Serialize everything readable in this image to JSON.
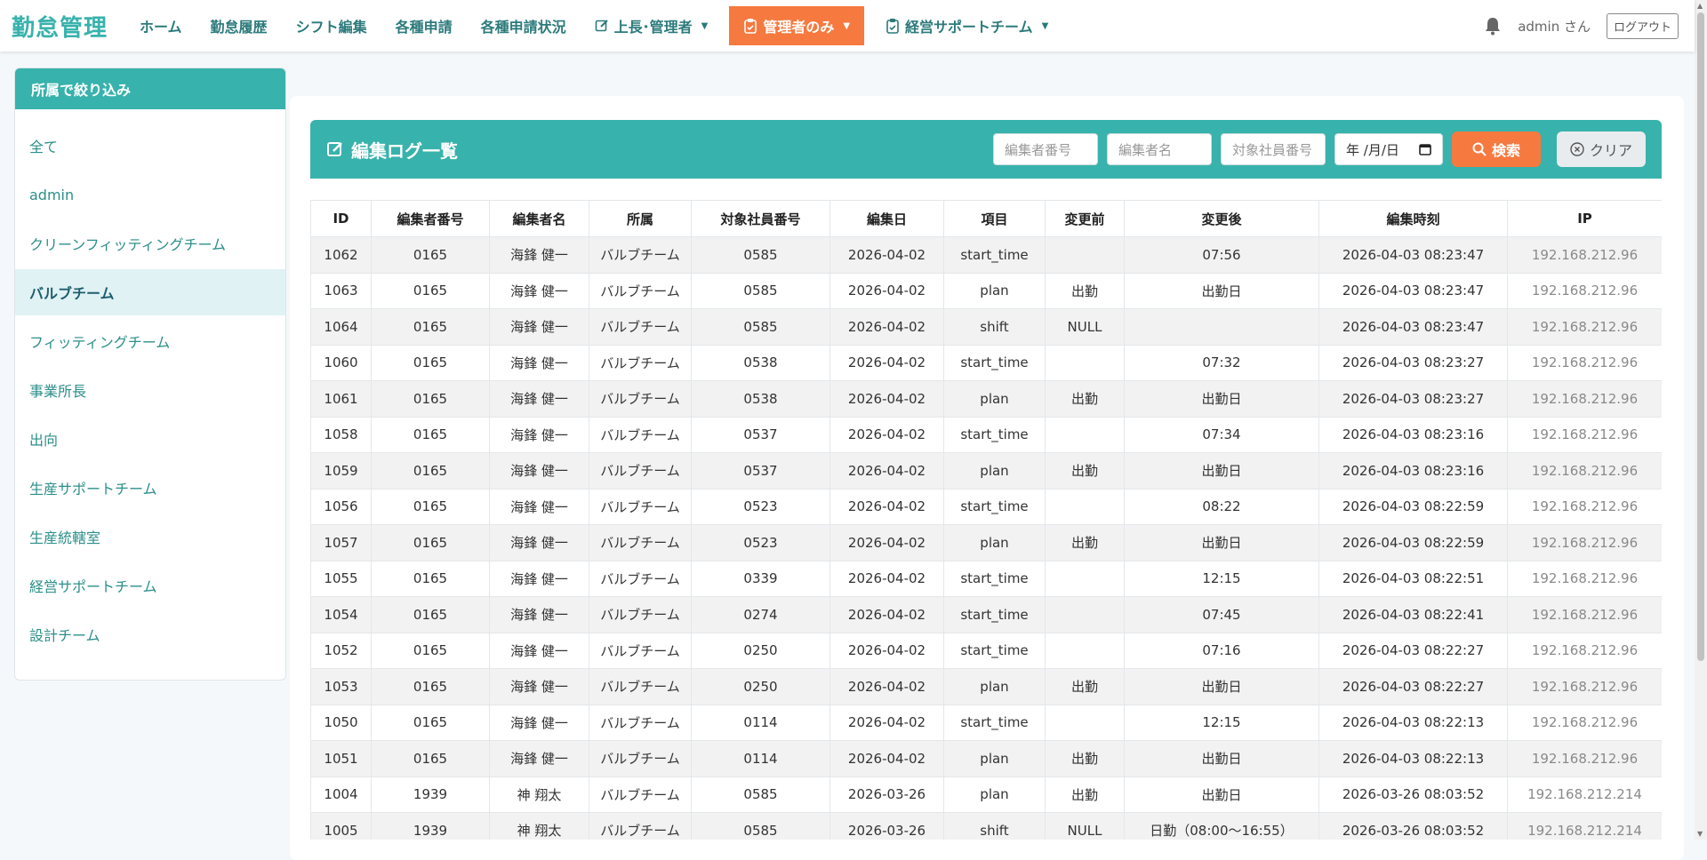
{
  "nav": {
    "brand": "勤怠管理",
    "items": [
      {
        "label": "ホーム"
      },
      {
        "label": "勤怠履歴"
      },
      {
        "label": "シフト編集"
      },
      {
        "label": "各種申請"
      },
      {
        "label": "各種申請状況"
      },
      {
        "label": "上長･管理者"
      },
      {
        "label": "管理者のみ"
      },
      {
        "label": "経営サポートチーム"
      }
    ],
    "user": "admin さん",
    "logout": "ログアウト"
  },
  "sidebar": {
    "title": "所属で絞り込み",
    "items": [
      {
        "label": "全て"
      },
      {
        "label": "admin"
      },
      {
        "label": "クリーンフィッティングチーム"
      },
      {
        "label": "バルブチーム"
      },
      {
        "label": "フィッティングチーム"
      },
      {
        "label": "事業所長"
      },
      {
        "label": "出向"
      },
      {
        "label": "生産サポートチーム"
      },
      {
        "label": "生産統轄室"
      },
      {
        "label": "経営サポートチーム"
      },
      {
        "label": "設計チーム"
      }
    ]
  },
  "panel": {
    "title": "編集ログ一覧",
    "filters": {
      "editor_no_placeholder": "編集者番号",
      "editor_name_placeholder": "編集者名",
      "target_no_placeholder": "対象社員番号",
      "date_placeholder": "年 /月/日"
    },
    "search_label": "検索",
    "clear_label": "クリア"
  },
  "table": {
    "headers": [
      "ID",
      "編集者番号",
      "編集者名",
      "所属",
      "対象社員番号",
      "編集日",
      "項目",
      "変更前",
      "変更後",
      "編集時刻",
      "IP"
    ],
    "rows": [
      [
        "1062",
        "0165",
        "海鋒 健一",
        "バルブチーム",
        "0585",
        "2026-04-02",
        "start_time",
        "",
        "07:56",
        "2026-04-03 08:23:47",
        "192.168.212.96"
      ],
      [
        "1063",
        "0165",
        "海鋒 健一",
        "バルブチーム",
        "0585",
        "2026-04-02",
        "plan",
        "出勤",
        "出勤日",
        "2026-04-03 08:23:47",
        "192.168.212.96"
      ],
      [
        "1064",
        "0165",
        "海鋒 健一",
        "バルブチーム",
        "0585",
        "2026-04-02",
        "shift",
        "NULL",
        "",
        "2026-04-03 08:23:47",
        "192.168.212.96"
      ],
      [
        "1060",
        "0165",
        "海鋒 健一",
        "バルブチーム",
        "0538",
        "2026-04-02",
        "start_time",
        "",
        "07:32",
        "2026-04-03 08:23:27",
        "192.168.212.96"
      ],
      [
        "1061",
        "0165",
        "海鋒 健一",
        "バルブチーム",
        "0538",
        "2026-04-02",
        "plan",
        "出勤",
        "出勤日",
        "2026-04-03 08:23:27",
        "192.168.212.96"
      ],
      [
        "1058",
        "0165",
        "海鋒 健一",
        "バルブチーム",
        "0537",
        "2026-04-02",
        "start_time",
        "",
        "07:34",
        "2026-04-03 08:23:16",
        "192.168.212.96"
      ],
      [
        "1059",
        "0165",
        "海鋒 健一",
        "バルブチーム",
        "0537",
        "2026-04-02",
        "plan",
        "出勤",
        "出勤日",
        "2026-04-03 08:23:16",
        "192.168.212.96"
      ],
      [
        "1056",
        "0165",
        "海鋒 健一",
        "バルブチーム",
        "0523",
        "2026-04-02",
        "start_time",
        "",
        "08:22",
        "2026-04-03 08:22:59",
        "192.168.212.96"
      ],
      [
        "1057",
        "0165",
        "海鋒 健一",
        "バルブチーム",
        "0523",
        "2026-04-02",
        "plan",
        "出勤",
        "出勤日",
        "2026-04-03 08:22:59",
        "192.168.212.96"
      ],
      [
        "1055",
        "0165",
        "海鋒 健一",
        "バルブチーム",
        "0339",
        "2026-04-02",
        "start_time",
        "",
        "12:15",
        "2026-04-03 08:22:51",
        "192.168.212.96"
      ],
      [
        "1054",
        "0165",
        "海鋒 健一",
        "バルブチーム",
        "0274",
        "2026-04-02",
        "start_time",
        "",
        "07:45",
        "2026-04-03 08:22:41",
        "192.168.212.96"
      ],
      [
        "1052",
        "0165",
        "海鋒 健一",
        "バルブチーム",
        "0250",
        "2026-04-02",
        "start_time",
        "",
        "07:16",
        "2026-04-03 08:22:27",
        "192.168.212.96"
      ],
      [
        "1053",
        "0165",
        "海鋒 健一",
        "バルブチーム",
        "0250",
        "2026-04-02",
        "plan",
        "出勤",
        "出勤日",
        "2026-04-03 08:22:27",
        "192.168.212.96"
      ],
      [
        "1050",
        "0165",
        "海鋒 健一",
        "バルブチーム",
        "0114",
        "2026-04-02",
        "start_time",
        "",
        "12:15",
        "2026-04-03 08:22:13",
        "192.168.212.96"
      ],
      [
        "1051",
        "0165",
        "海鋒 健一",
        "バルブチーム",
        "0114",
        "2026-04-02",
        "plan",
        "出勤",
        "出勤日",
        "2026-04-03 08:22:13",
        "192.168.212.96"
      ],
      [
        "1004",
        "1939",
        "神 翔太",
        "バルブチーム",
        "0585",
        "2026-03-26",
        "plan",
        "出勤",
        "出勤日",
        "2026-03-26 08:03:52",
        "192.168.212.214"
      ],
      [
        "1005",
        "1939",
        "神 翔太",
        "バルブチーム",
        "0585",
        "2026-03-26",
        "shift",
        "NULL",
        "日勤（08:00～16:55）",
        "2026-03-26 08:03:52",
        "192.168.212.214"
      ]
    ]
  },
  "colors": {
    "accent": "#38b2ac",
    "active_nav": "#f6793f",
    "search_button": "#f6793f"
  },
  "icons": {
    "edit": "edit-icon",
    "clipboard": "clipboard-icon",
    "bell": "bell-icon",
    "search": "search-icon",
    "clear": "x-circle-icon",
    "calendar": "calendar-icon"
  }
}
